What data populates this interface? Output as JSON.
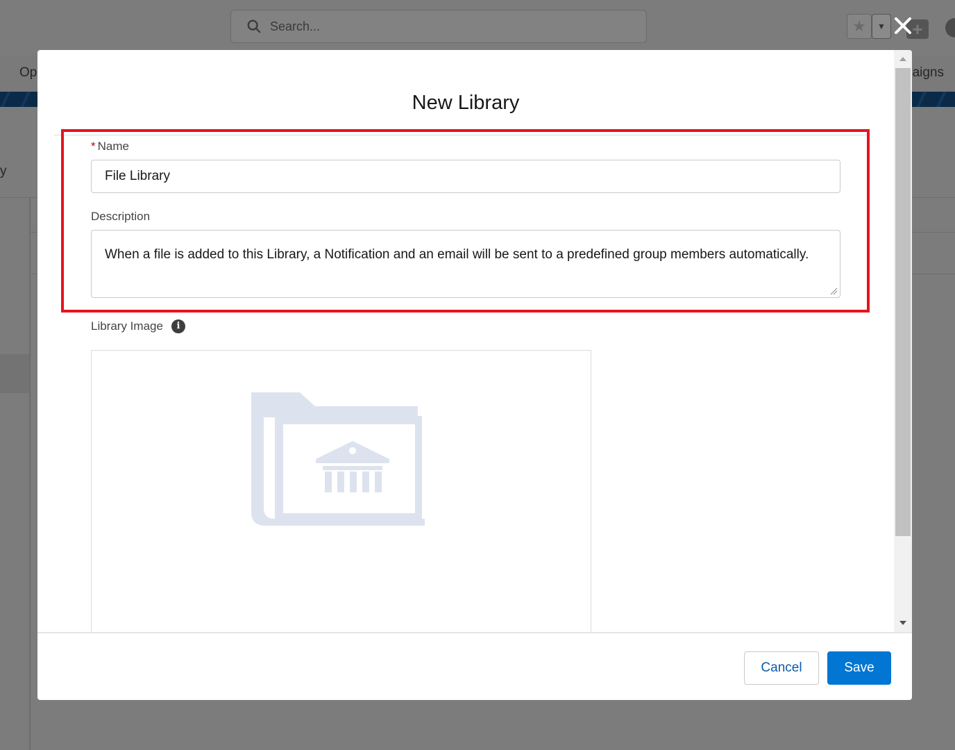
{
  "background": {
    "search_placeholder": "Search...",
    "nav_left_text": "Op",
    "nav_right_text": "paigns",
    "side_text": "y"
  },
  "modal": {
    "title": "New Library",
    "name_field": {
      "required_marker": "*",
      "label": "Name",
      "value": "File Library"
    },
    "description_field": {
      "label": "Description",
      "value": "When a file is added to this Library, a Notification and an email will be sent to a predefined group members automatically."
    },
    "library_image_field": {
      "label": "Library Image",
      "info_icon": "info-icon",
      "placeholder_icon": "library-folder-icon"
    },
    "footer": {
      "cancel_label": "Cancel",
      "save_label": "Save"
    }
  },
  "colors": {
    "brand_blue": "#0176d3",
    "highlight_red": "#e4141f",
    "required_red": "#ba0517",
    "placeholder_icon": "#dde3ee"
  }
}
